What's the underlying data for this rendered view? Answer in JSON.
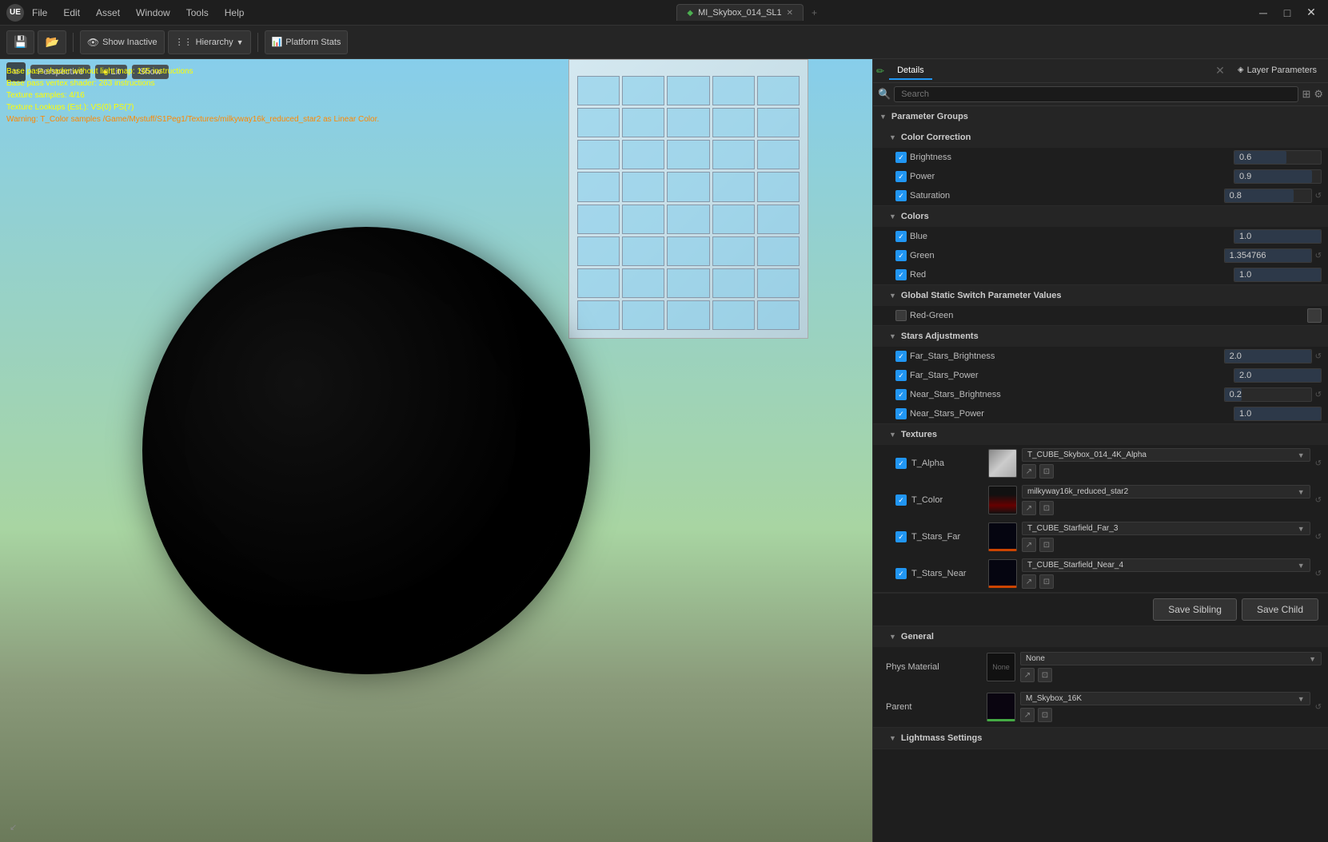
{
  "titlebar": {
    "app_icon": "UE",
    "menu": [
      "File",
      "Edit",
      "Asset",
      "Window",
      "Tools",
      "Help"
    ],
    "tab_title": "MI_Skybox_014_SL1",
    "window_controls": [
      "─",
      "□",
      "✕"
    ]
  },
  "toolbar": {
    "show_inactive": "Show Inactive",
    "hierarchy": "Hierarchy",
    "platform_stats": "Platform Stats"
  },
  "viewport": {
    "mode": "Perspective",
    "shading": "Lit",
    "show": "Show",
    "debug_lines": [
      "Base pass shader without light map: 165 instructions",
      "Base pass vertex shader: 263 instructions",
      "Texture samples: 4/16",
      "Texture Lookups (Est.): VS(0) PS(7)",
      "Warning: T_Color samples /Game/Mystuff/S1Peg1/Textures/milkyway16k_reduced_star2 as Linear Color."
    ]
  },
  "panel": {
    "tabs": [
      {
        "label": "Details",
        "active": true
      },
      {
        "label": "Layer Parameters",
        "active": false
      }
    ],
    "search_placeholder": "Search",
    "sections": {
      "parameter_groups": "Parameter Groups",
      "color_correction": {
        "label": "Color Correction",
        "params": [
          {
            "name": "Brightness",
            "value": "0.6",
            "checked": true
          },
          {
            "name": "Power",
            "value": "0.9",
            "checked": true
          },
          {
            "name": "Saturation",
            "value": "0.8",
            "checked": true
          }
        ]
      },
      "colors": {
        "label": "Colors",
        "params": [
          {
            "name": "Blue",
            "value": "1.0",
            "checked": true
          },
          {
            "name": "Green",
            "value": "1.354766",
            "checked": true
          },
          {
            "name": "Red",
            "value": "1.0",
            "checked": true
          }
        ]
      },
      "global_static_switch": {
        "label": "Global Static Switch Parameter Values",
        "params": [
          {
            "name": "Red-Green",
            "value": "",
            "checked": false
          }
        ]
      },
      "stars_adjustments": {
        "label": "Stars Adjustments",
        "params": [
          {
            "name": "Far_Stars_Brightness",
            "value": "2.0",
            "checked": true
          },
          {
            "name": "Far_Stars_Power",
            "value": "2.0",
            "checked": true
          },
          {
            "name": "Near_Stars_Brightness",
            "value": "0.2",
            "checked": true
          },
          {
            "name": "Near_Stars_Power",
            "value": "1.0",
            "checked": true
          }
        ]
      },
      "textures": {
        "label": "Textures",
        "items": [
          {
            "name": "T_Alpha",
            "texture": "T_CUBE_Skybox_014_4K_Alpha",
            "checked": true
          },
          {
            "name": "T_Color",
            "texture": "milkyway16k_reduced_star2",
            "checked": true
          },
          {
            "name": "T_Stars_Far",
            "texture": "T_CUBE_Starfield_Far_3",
            "checked": true
          },
          {
            "name": "T_Stars_Near",
            "texture": "T_CUBE_Starfield_Near_4",
            "checked": true
          }
        ]
      },
      "general": {
        "label": "General",
        "phys_material": {
          "label": "Phys Material",
          "value": "None"
        },
        "parent": {
          "label": "Parent",
          "value": "M_Skybox_16K"
        }
      },
      "lightmass_settings": {
        "label": "Lightmass Settings"
      }
    },
    "buttons": {
      "save_sibling": "Save Sibling",
      "save_child": "Save Child"
    }
  }
}
